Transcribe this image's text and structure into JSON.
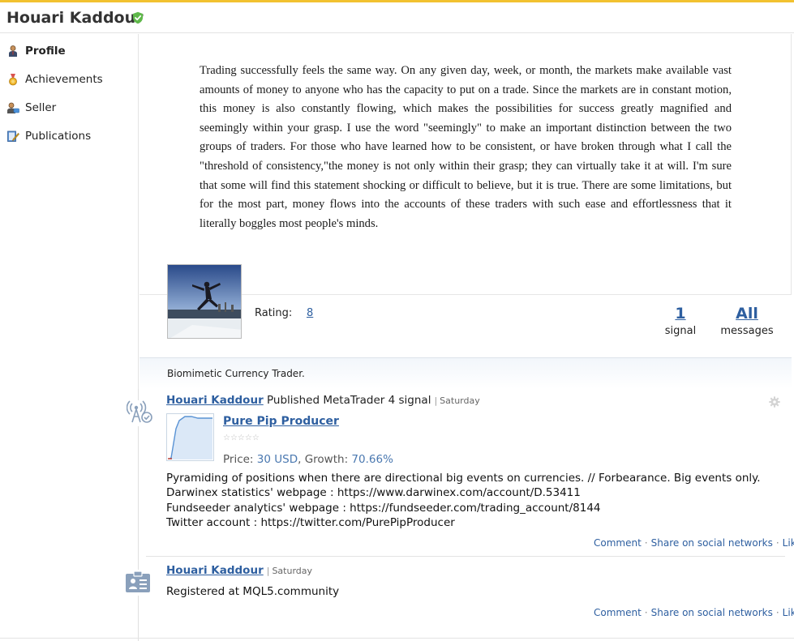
{
  "header": {
    "name": "Houari Kaddour",
    "verified_icon": "verified-shield-icon",
    "accent": "#f2c230"
  },
  "sidebar": {
    "items": [
      {
        "label": "Profile",
        "icon": "user-icon",
        "active": true
      },
      {
        "label": "Achievements",
        "icon": "medal-icon",
        "active": false
      },
      {
        "label": "Seller",
        "icon": "seller-icon",
        "active": false
      },
      {
        "label": "Publications",
        "icon": "pencil-book-icon",
        "active": false
      }
    ]
  },
  "quote": {
    "text": "Trading successfully feels the same way. On any given day, week, or month, the markets make available vast amounts of money to anyone who has the capacity to put on a trade. Since the markets are in constant motion, this money is also constantly flowing, which makes the possibilities for success greatly magnified and seemingly within your grasp. I use the word \"seemingly\" to make an important distinction between the two groups of traders. For those who have learned how to be consistent, or have broken through what I call the \"threshold of consistency,\"the money is not only within their grasp; they can virtually take it at will. I'm sure that some will find this statement shocking or difficult to believe, but it is true. There are some limitations, but for the most part, money flows into the accounts of these traders with such ease and effortlessness that it literally boggles most people's minds."
  },
  "profile": {
    "rating_label": "Rating:",
    "rating_value": "8",
    "signals_count": "1",
    "signals_label": "signal",
    "messages_count": "All",
    "messages_label": "messages",
    "bio": "Biomimetic Currency Trader."
  },
  "feed": {
    "post1": {
      "author": "Houari Kaddour",
      "action": "Published MetaTrader 4 signal",
      "sep": "|",
      "date": "Saturday",
      "signal_title": "Pure Pip Producer",
      "stars": "☆☆☆☆☆",
      "price_label": "Price:",
      "price_value": "30 USD",
      "growth_label": "Growth:",
      "growth_value": "70.66%",
      "lines": [
        "Pyramiding of positions when there are directional big events on currencies. // Forbearance. Big events only.",
        "Darwinex statistics' webpage : https://www.darwinex.com/account/D.53411",
        "Fundseeder analytics' webpage : https://fundseeder.com/trading_account/8144",
        "Twitter account : https://twitter.com/PurePipProducer"
      ],
      "actions": {
        "comment": "Comment",
        "share": "Share on social networks",
        "like": "Like",
        "dot": "·"
      }
    },
    "post2": {
      "author": "Houari Kaddour",
      "sep": "|",
      "date": "Saturday",
      "text": "Registered at MQL5.community",
      "actions": {
        "comment": "Comment",
        "share": "Share on social networks",
        "like": "Like",
        "dot": "·"
      }
    }
  },
  "colors": {
    "link": "#2e5fa0",
    "verified": "#5fb84a",
    "border": "#e3e3e3"
  }
}
